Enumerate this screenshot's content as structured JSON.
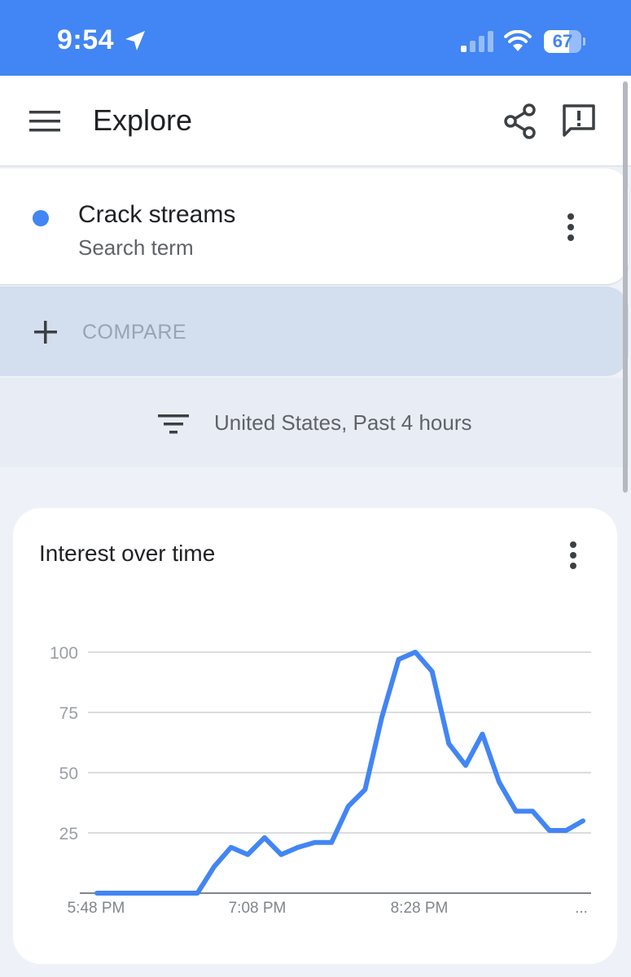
{
  "status_bar": {
    "time": "9:54",
    "battery": "67",
    "battery_level": 0.67,
    "icons": [
      "location-arrow-icon",
      "signal-icon",
      "wifi-icon",
      "battery-icon"
    ]
  },
  "app_bar": {
    "title": "Explore",
    "icons": [
      "menu-icon",
      "share-icon",
      "feedback-icon"
    ]
  },
  "search_term": {
    "name": "Crack streams",
    "subtitle": "Search term",
    "color": "#4285f4"
  },
  "compare": {
    "label": "COMPARE"
  },
  "filters": {
    "text": "United States, Past 4 hours"
  },
  "chart_card": {
    "title": "Interest over time"
  },
  "chart_data": {
    "type": "line",
    "title": "Interest over time",
    "xlabel": "",
    "ylabel": "",
    "ylim": [
      0,
      100
    ],
    "yticks": [
      25,
      50,
      75,
      100
    ],
    "x_tick_labels": [
      "5:48 PM",
      "7:08 PM",
      "8:28 PM",
      "..."
    ],
    "grid": true,
    "series": [
      {
        "color": "#4285f4",
        "values": [
          0,
          0,
          0,
          0,
          0,
          0,
          0,
          11,
          19,
          16,
          23,
          16,
          19,
          21,
          21,
          36,
          43,
          73,
          97,
          100,
          92,
          62,
          53,
          66,
          46,
          34,
          34,
          26,
          26,
          30
        ]
      }
    ]
  }
}
